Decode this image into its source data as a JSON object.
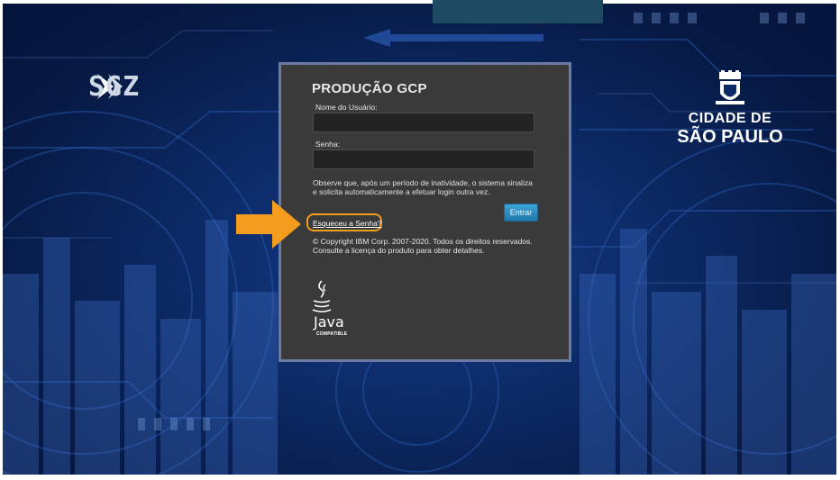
{
  "brand": {
    "logo_text": "SGZ"
  },
  "city": {
    "line1": "CIDADE DE",
    "line2": "SÃO PAULO"
  },
  "login": {
    "title": "PRODUÇÃO GCP",
    "username_label": "Nome do Usuário:",
    "username_value": "",
    "password_label": "Senha:",
    "password_value": "",
    "notice": "Observe que, após um período de inatividade, o sistema sinaliza e solicita automaticamente a efetuar login outra vez.",
    "submit_label": "Entrar",
    "forgot_label": "Esqueceu a Senha?",
    "copyright_line1": "© Copyright IBM Corp. 2007-2020. Todos os direitos reservados.",
    "copyright_line2": "Consulte a licença do produto para obter detalhes."
  },
  "java": {
    "word": "Java",
    "tagline": "COMPATIBLE"
  },
  "colors": {
    "highlight": "#f39c1e",
    "button": "#1f78ad",
    "panel": "#3a3a3a",
    "panel_border": "#6b7ba6"
  }
}
